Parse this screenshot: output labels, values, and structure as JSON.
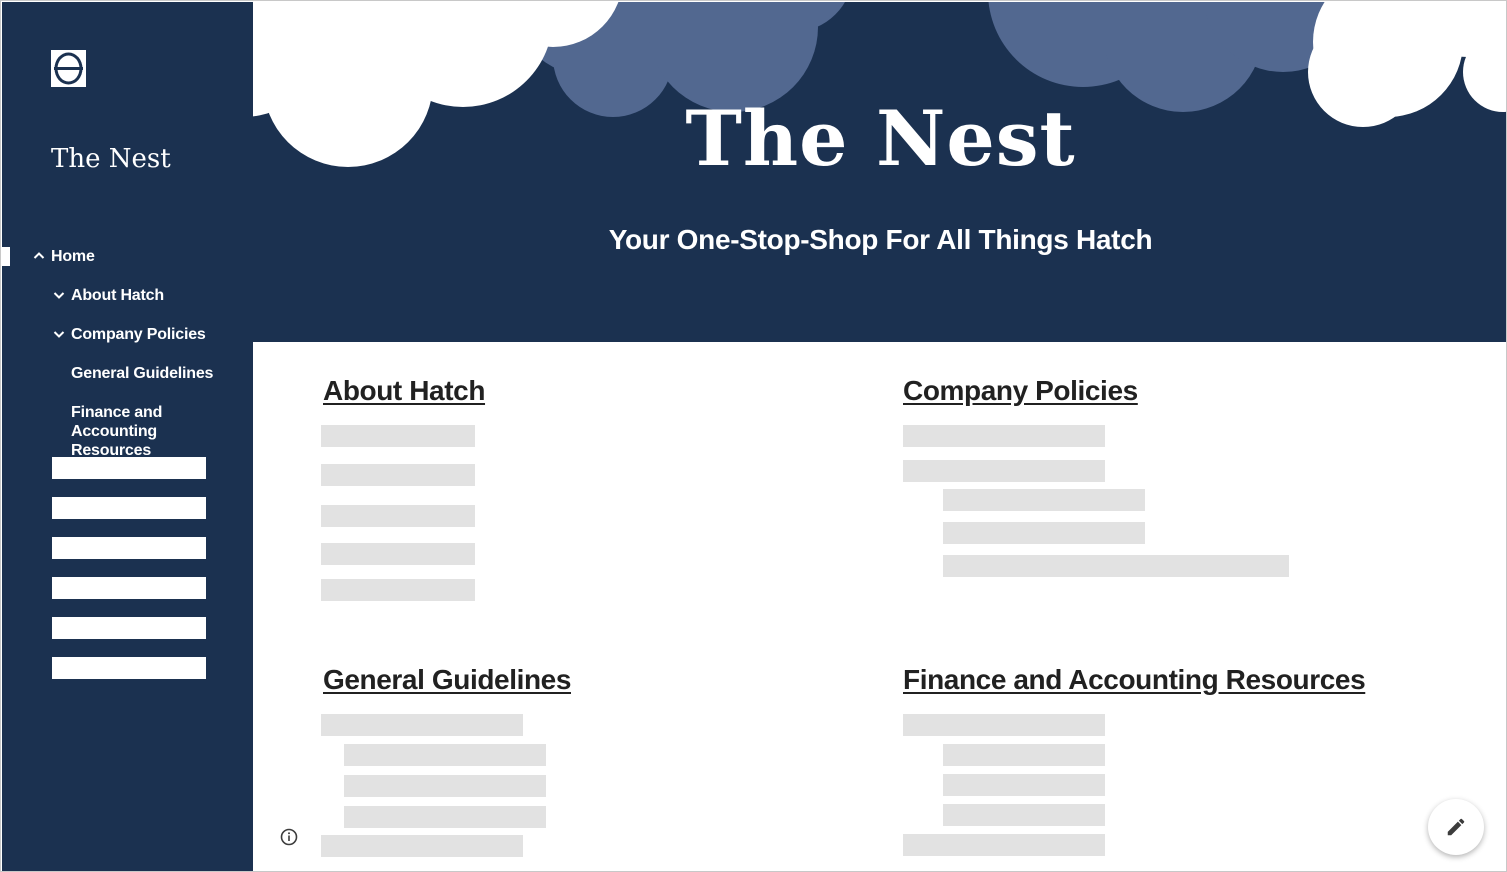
{
  "site": {
    "title": "The Nest"
  },
  "sidebar": {
    "items": [
      {
        "label": "Home"
      },
      {
        "label": "About Hatch"
      },
      {
        "label": "Company Policies"
      },
      {
        "label": "General Guidelines"
      },
      {
        "label": "Finance and Accounting Resources"
      }
    ]
  },
  "header": {
    "title": "The Nest",
    "subtitle": "Your One-Stop-Shop For All Things Hatch"
  },
  "sections": [
    {
      "heading": "About Hatch"
    },
    {
      "heading": "Company Policies"
    },
    {
      "heading": "General Guidelines"
    },
    {
      "heading": "Finance and Accounting Resources"
    }
  ],
  "icons": {
    "logo": "hatch-logo-icon",
    "expand": "chevron-up-icon",
    "collapse": "chevron-down-icon",
    "info": "info-icon",
    "edit": "pencil-icon"
  },
  "colors": {
    "navy": "#1b3150",
    "cloud_light": "#ffffff",
    "cloud_mid": "#526890",
    "placeholder": "#e2e2e2"
  }
}
